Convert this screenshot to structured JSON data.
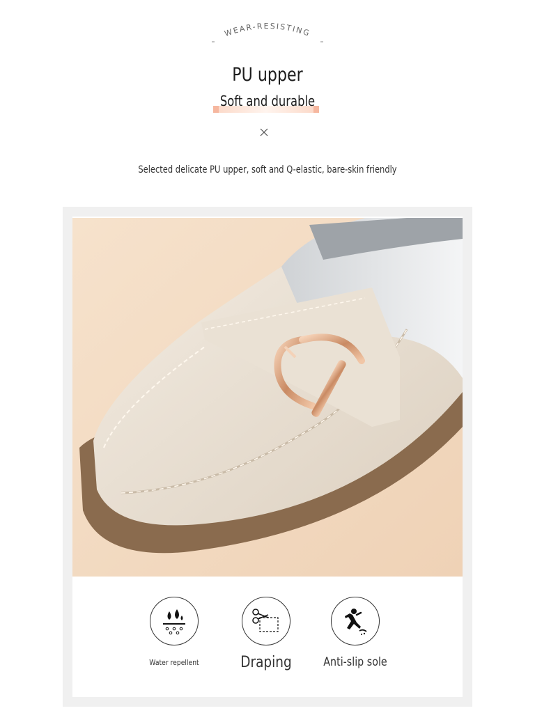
{
  "tagline": "WEAR-RESISTING",
  "title": "PU upper",
  "subtitle": "Soft and durable",
  "description": "Selected delicate PU upper, soft and Q-elastic, bare-skin friendly",
  "product_image": {
    "icon": "shoe-photo",
    "colors": {
      "background": "#f2dcc4",
      "upper": "#ece3d6",
      "sole": "#8a6b4e",
      "buckle": "#d9a07e"
    }
  },
  "features": [
    {
      "label": "Water repellent",
      "icon": "water-drops-icon"
    },
    {
      "label": "Draping",
      "icon": "scissors-icon"
    },
    {
      "label": "Anti-slip sole",
      "icon": "slip-person-icon"
    }
  ]
}
